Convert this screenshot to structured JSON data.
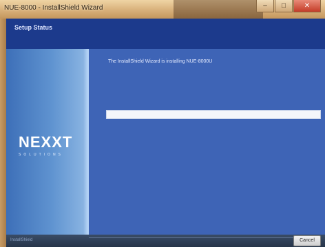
{
  "window": {
    "title": "NUE-8000 - InstallShield Wizard",
    "controls": {
      "minimize": "–",
      "maximize": "□",
      "close": "✕"
    }
  },
  "header": {
    "page_title": "Setup Status"
  },
  "left_panel": {
    "brand": "NEXXT",
    "tagline": "SOLUTIONS"
  },
  "main": {
    "status_text": "The InstallShield Wizard is installing NUE-8000U",
    "progress": 0
  },
  "footer": {
    "brand_text": "InstallShield",
    "cancel_label": "Cancel"
  },
  "colors": {
    "header_bg": "#1c3a8c",
    "main_bg": "#3e64b6",
    "panel_gradient_start": "#3d6fb8",
    "close_button": "#c43c28"
  }
}
